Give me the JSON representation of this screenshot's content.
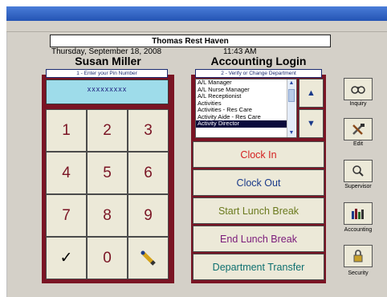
{
  "header": {
    "title": "Thomas Rest Haven",
    "date": "Thursday, September 18, 2008",
    "time": "11:43 AM"
  },
  "employee": {
    "name": "Susan Miller",
    "pin_prompt": "1 - Enter your Pin Number",
    "pin_mask": "xxxxxxxxx"
  },
  "keypad": {
    "keys": [
      "1",
      "2",
      "3",
      "4",
      "5",
      "6",
      "7",
      "8",
      "9",
      "✓",
      "0",
      ""
    ]
  },
  "department": {
    "title": "Accounting Login",
    "prompt": "2 - Verify or Change Department",
    "items": [
      "A/L Manager",
      "A/L Nurse Manager",
      "A/L Receptionist",
      "Activities",
      "Activities - Res Care",
      "Activity Aide - Res Care",
      "Activity Director"
    ],
    "selected": "Activity Director"
  },
  "actions": {
    "clock_in": "Clock In",
    "clock_out": "Clock Out",
    "start_lunch": "Start Lunch Break",
    "end_lunch": "End Lunch Break",
    "transfer": "Department Transfer"
  },
  "sidebar": {
    "inquiry": "Inquiry",
    "edit": "Edit",
    "supervisor": "Supervisor",
    "accounting": "Accounting",
    "security": "Security"
  },
  "colors": {
    "panel": "#7a1424",
    "clock_in": "#d42020",
    "clock_out": "#1a3a8a",
    "start_lunch": "#6b7a1e",
    "end_lunch": "#7a1a7a",
    "transfer": "#0e7070"
  }
}
